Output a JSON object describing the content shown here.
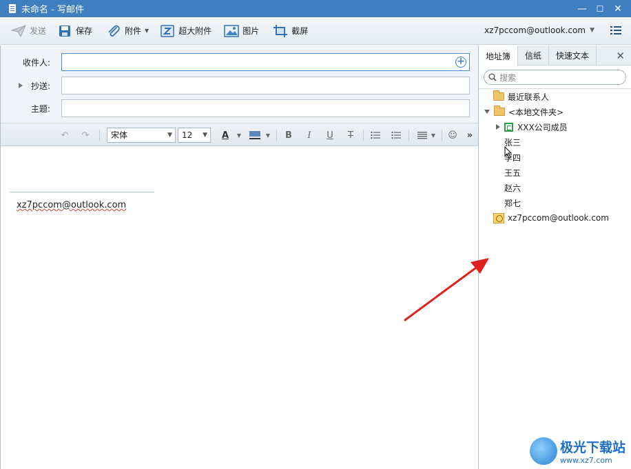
{
  "window": {
    "title": "未命名 - 写邮件",
    "minimize": "—",
    "maximize": "☐",
    "close": "✕"
  },
  "toolbar": {
    "send": "发送",
    "save": "保存",
    "attachment": "附件",
    "large_attachment": "超大附件",
    "image": "图片",
    "screenshot": "截屏",
    "account": "xz7pccom@outlook.com"
  },
  "fields": {
    "to_label": "收件人:",
    "cc_label": "抄送:",
    "subject_label": "主题:",
    "to_value": "",
    "cc_value": "",
    "subject_value": ""
  },
  "format": {
    "font_family": "宋体",
    "font_size": "12"
  },
  "body": {
    "signature": "xz7pccom@outlook.com"
  },
  "panel": {
    "tabs": [
      "地址簿",
      "信纸",
      "快速文本"
    ],
    "search_placeholder": "搜索",
    "recent_contacts": "最近联系人",
    "local_folder": "<本地文件夹>",
    "group": "XXX公司成员",
    "contacts": [
      "张三",
      "李四",
      "王五",
      "赵六",
      "郑七"
    ],
    "account": "xz7pccom@outlook.com"
  },
  "watermark": {
    "name": "极光下载站",
    "url": "www.xz7.com"
  },
  "colors": {
    "titlebar": "#3f7fc0",
    "annotation_arrow": "#e02020"
  }
}
